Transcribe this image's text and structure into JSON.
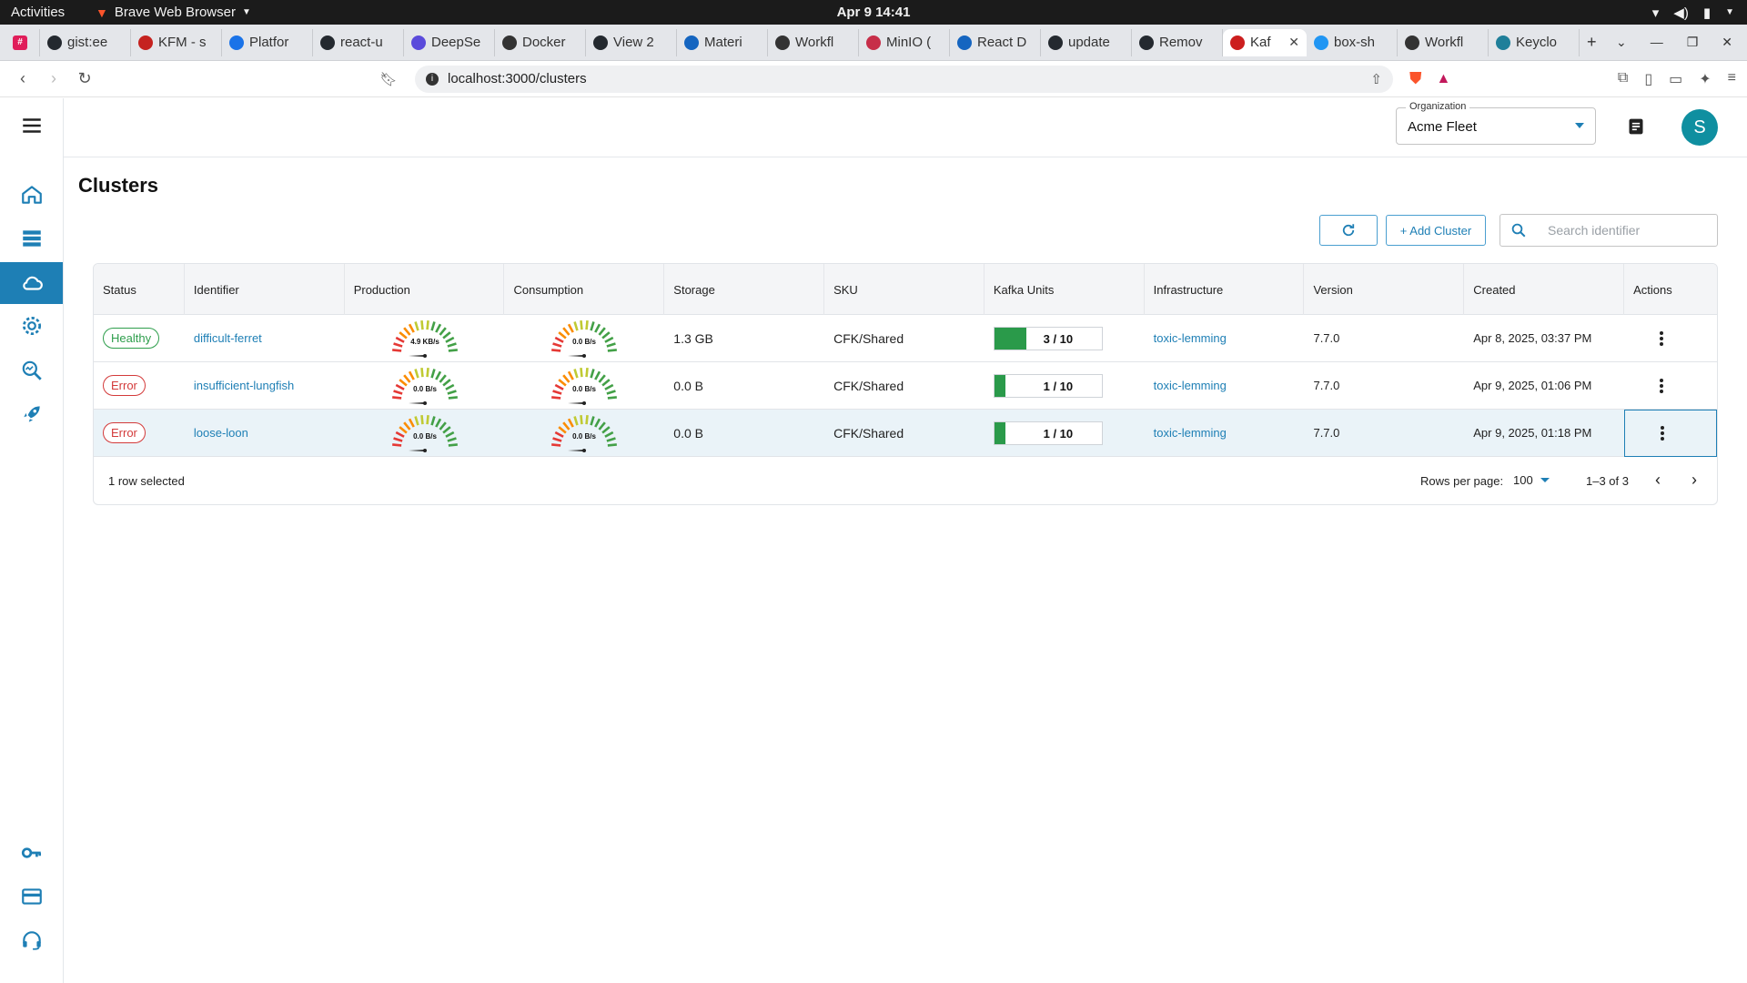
{
  "os": {
    "activities": "Activities",
    "app_name": "Brave Web Browser",
    "clock": "Apr 9  14:41"
  },
  "browser": {
    "tabs": [
      {
        "label": "gist:ee",
        "color": "#24292f"
      },
      {
        "label": "KFM - s",
        "color": "#c5221f"
      },
      {
        "label": "Platfor",
        "color": "#1a73e8"
      },
      {
        "label": "react-u",
        "color": "#24292f"
      },
      {
        "label": "DeepSe",
        "color": "#5b4bdb"
      },
      {
        "label": "Docker",
        "color": "#333333"
      },
      {
        "label": "View 2",
        "color": "#24292f"
      },
      {
        "label": "Materi",
        "color": "#1565c0"
      },
      {
        "label": "Workfl",
        "color": "#333333"
      },
      {
        "label": "MinIO (",
        "color": "#c72e49"
      },
      {
        "label": "React D",
        "color": "#1565c0"
      },
      {
        "label": "update",
        "color": "#24292f"
      },
      {
        "label": "Remov",
        "color": "#24292f"
      },
      {
        "label": "Kaf",
        "color": "#cc1f1f",
        "active": true
      },
      {
        "label": "box-sh",
        "color": "#2196f3"
      },
      {
        "label": "Workfl",
        "color": "#333333"
      },
      {
        "label": "Keyclo",
        "color": "#1f7f9a"
      }
    ],
    "url": "localhost:3000/clusters"
  },
  "header": {
    "org_label": "Organization",
    "org_value": "Acme Fleet",
    "avatar_letter": "S"
  },
  "page": {
    "title": "Clusters",
    "add_label": "+ Add Cluster",
    "search_placeholder": "Search identifier"
  },
  "table": {
    "columns": [
      "Status",
      "Identifier",
      "Production",
      "Consumption",
      "Storage",
      "SKU",
      "Kafka Units",
      "Infrastructure",
      "Version",
      "Created",
      "Actions"
    ],
    "rows": [
      {
        "status": "Healthy",
        "status_kind": "healthy",
        "identifier": "difficult-ferret",
        "production": "4.9 KB/s",
        "consumption": "0.0 B/s",
        "storage": "1.3 GB",
        "sku": "CFK/Shared",
        "units": "3 / 10",
        "units_fraction": 0.3,
        "infrastructure": "toxic-lemming",
        "version": "7.7.0",
        "created": "Apr 8, 2025, 03:37 PM"
      },
      {
        "status": "Error",
        "status_kind": "error",
        "identifier": "insufficient-lungfish",
        "production": "0.0 B/s",
        "consumption": "0.0 B/s",
        "storage": "0.0 B",
        "sku": "CFK/Shared",
        "units": "1 / 10",
        "units_fraction": 0.1,
        "infrastructure": "toxic-lemming",
        "version": "7.7.0",
        "created": "Apr 9, 2025, 01:06 PM"
      },
      {
        "status": "Error",
        "status_kind": "error",
        "identifier": "loose-loon",
        "production": "0.0 B/s",
        "consumption": "0.0 B/s",
        "storage": "0.0 B",
        "sku": "CFK/Shared",
        "units": "1 / 10",
        "units_fraction": 0.1,
        "infrastructure": "toxic-lemming",
        "version": "7.7.0",
        "created": "Apr 9, 2025, 01:18 PM",
        "selected": true
      }
    ]
  },
  "footer": {
    "selection": "1 row selected",
    "rows_per_page_label": "Rows per page:",
    "rows_per_page_value": "100",
    "range": "1–3 of 3"
  },
  "colors": {
    "accent": "#1e7fb5",
    "healthy": "#2e9e4c",
    "error": "#d33a3a",
    "units_fill": "#2a9a4a"
  }
}
